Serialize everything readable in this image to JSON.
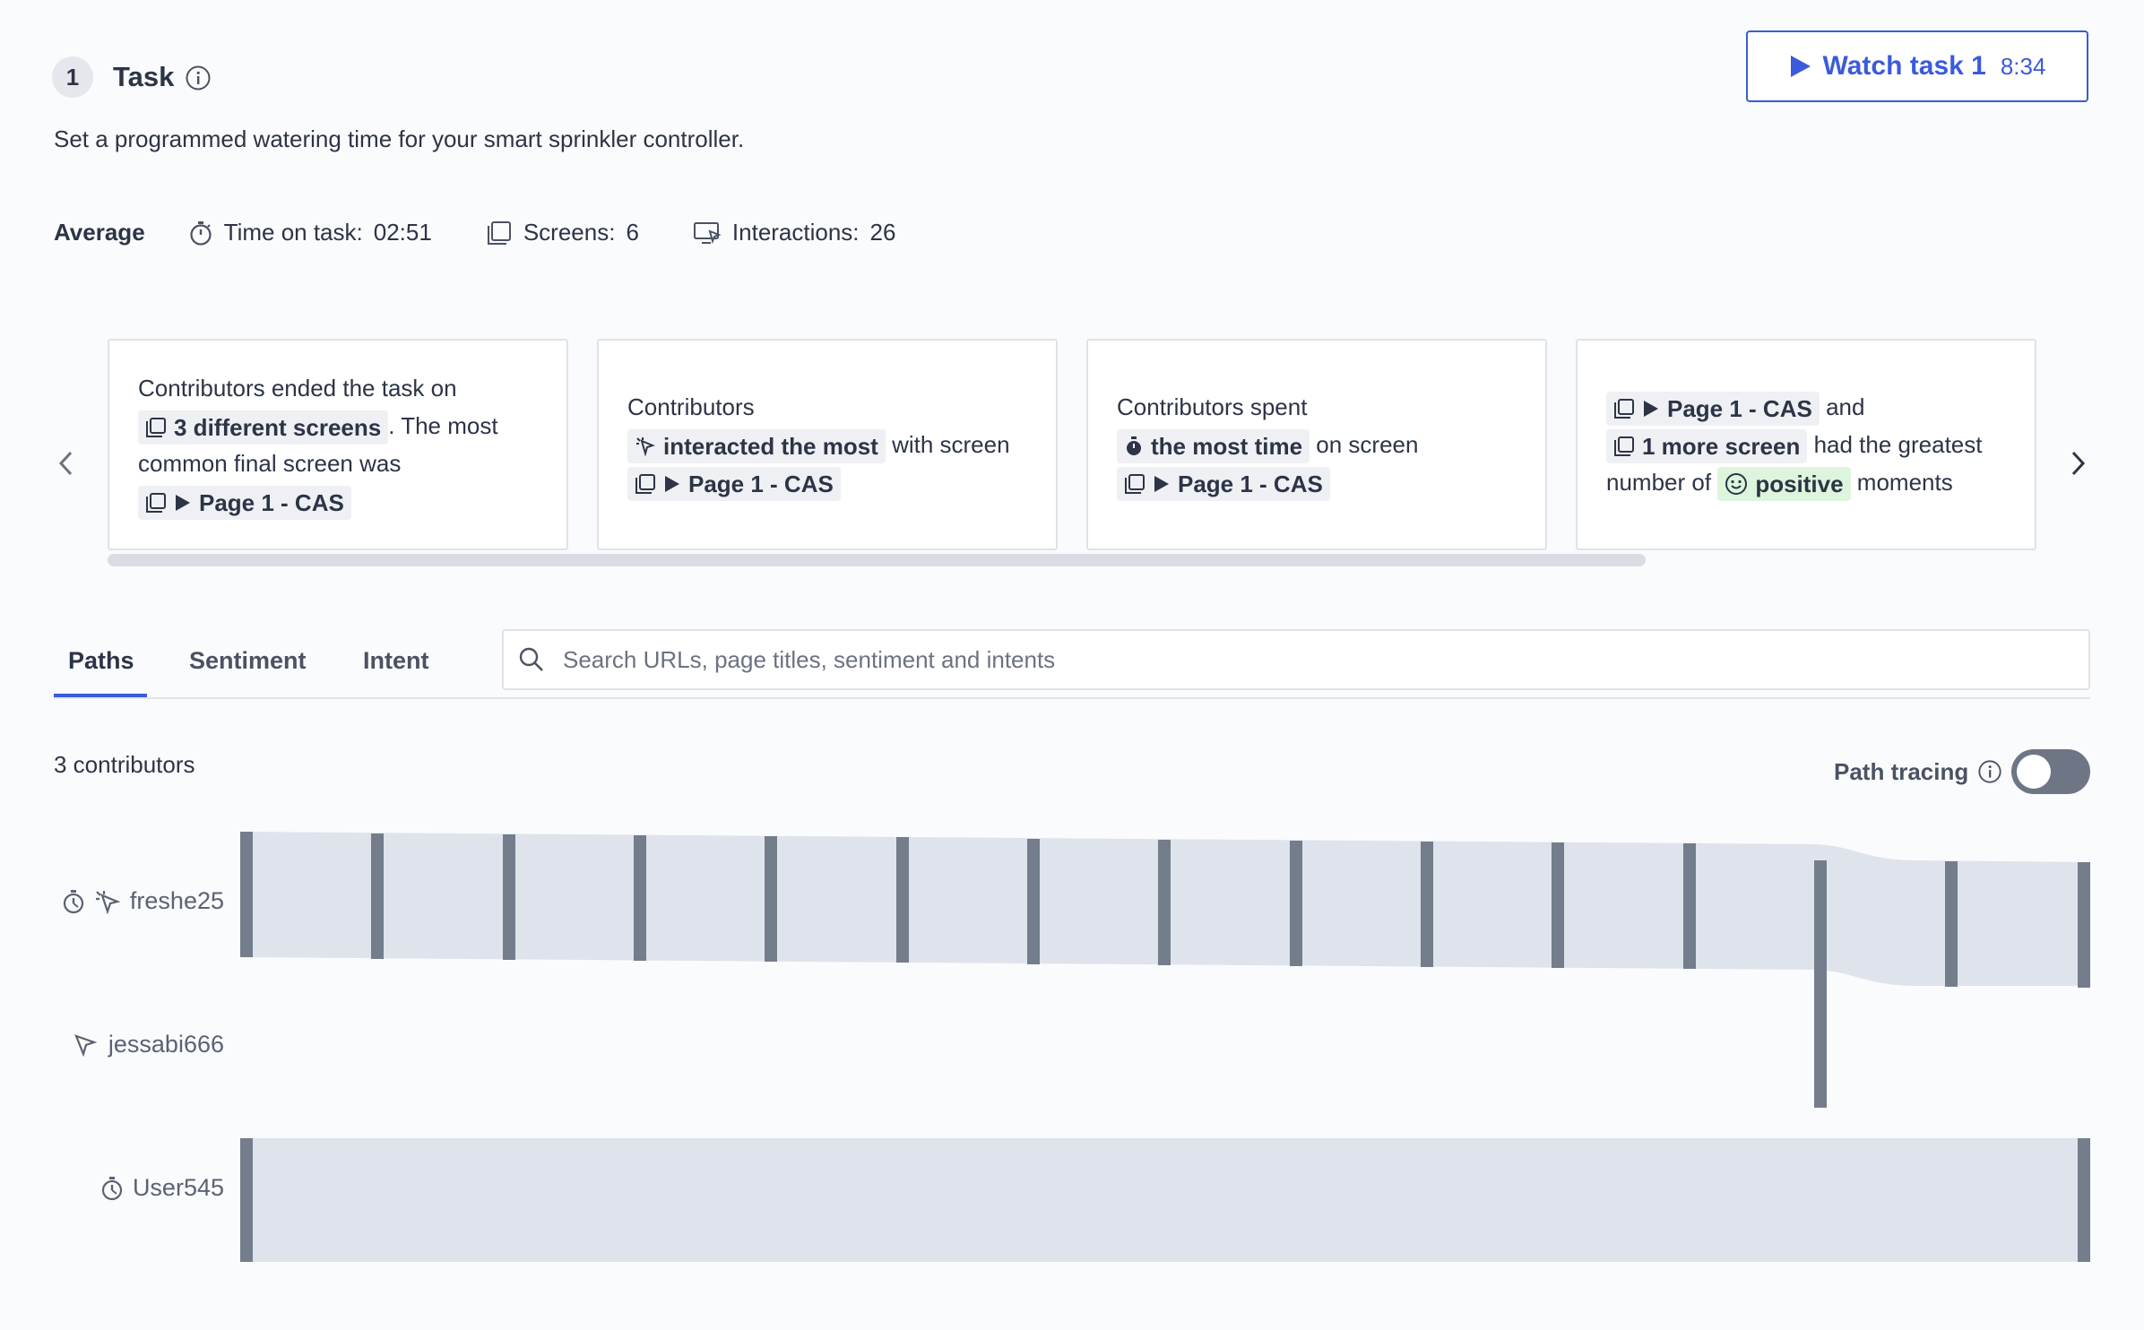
{
  "header": {
    "step_number": "1",
    "title": "Task",
    "description": "Set a programmed watering time for your smart sprinkler controller.",
    "watch_label": "Watch task 1",
    "watch_duration": "8:34"
  },
  "stats": {
    "label": "Average",
    "time_label": "Time on task:",
    "time_value": "02:51",
    "screens_label": "Screens:",
    "screens_value": "6",
    "interactions_label": "Interactions:",
    "interactions_value": "26"
  },
  "cards": {
    "c1": {
      "pre": "Contributors ended the task on",
      "chip": "3 different screens",
      "mid": ". The most common final screen was",
      "page": "Page 1 - CAS"
    },
    "c2": {
      "pre": "Contributors",
      "chip": "interacted the most",
      "mid": "with screen",
      "page": "Page 1 - CAS"
    },
    "c3": {
      "pre": "Contributors spent",
      "chip": "the most time",
      "mid": "on screen",
      "page": "Page 1 - CAS"
    },
    "c4": {
      "page": "Page 1 - CAS",
      "and": "and",
      "more": "1 more screen",
      "mid": "had the greatest number of",
      "sentiment": "positive",
      "post": "moments"
    }
  },
  "tabs": [
    "Paths",
    "Sentiment",
    "Intent"
  ],
  "search": {
    "placeholder": "Search URLs, page titles, sentiment and intents",
    "value": ""
  },
  "contributors_count": "3 contributors",
  "path_tracing": {
    "label": "Path tracing",
    "enabled": false
  },
  "rows": [
    {
      "name": "freshe25",
      "icons": [
        "stopwatch-icon",
        "click-icon"
      ]
    },
    {
      "name": "jessabi666",
      "icons": [
        "cursor-icon"
      ]
    },
    {
      "name": "User545",
      "icons": [
        "stopwatch-icon"
      ]
    }
  ],
  "colors": {
    "accent": "#3b5bdb",
    "flow_band": "#dfe3ec",
    "node": "#737d8c",
    "positive_chip": "#dcf5dc"
  }
}
